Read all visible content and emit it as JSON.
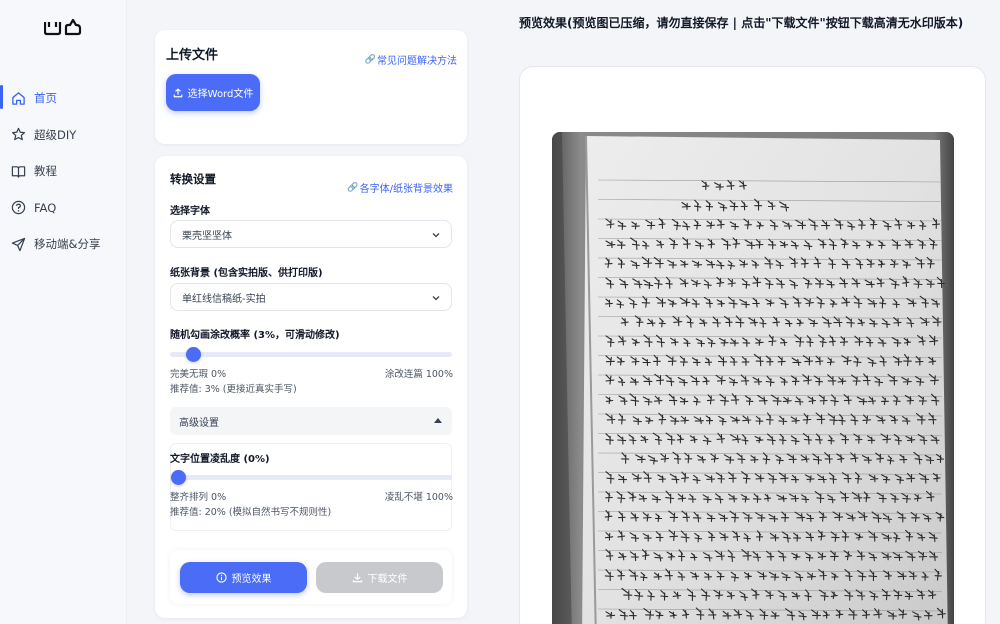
{
  "sidebar": {
    "items": [
      {
        "label": "首页",
        "icon": "home-icon",
        "active": true
      },
      {
        "label": "超级DIY",
        "icon": "star-icon",
        "active": false
      },
      {
        "label": "教程",
        "icon": "book-icon",
        "active": false
      },
      {
        "label": "FAQ",
        "icon": "help-icon",
        "active": false
      },
      {
        "label": "移动端&分享",
        "icon": "send-icon",
        "active": false
      }
    ]
  },
  "upload": {
    "title": "上传文件",
    "faq_link": "常见问题解决方法",
    "button": "选择Word文件"
  },
  "settings": {
    "title": "转换设置",
    "effects_link": "各字体/纸张背景效果",
    "font_label": "选择字体",
    "font_value": "栗壳坚坚体",
    "paper_label": "纸张背景 (包含实拍版、供打印版)",
    "paper_value": "单红线信稿纸-实拍",
    "scribble_label": "随机勾画涂改概率 (3%，可滑动修改)",
    "scribble_value": 3,
    "scribble_min": "完美无瑕 0%",
    "scribble_max": "涂改连篇 100%",
    "scribble_recommend": "推荐值: 3% (更接近真实手写)",
    "advanced_label": "高级设置",
    "disorder_label": "文字位置凌乱度 (0%)",
    "disorder_value": 0,
    "disorder_min": "整齐排列 0%",
    "disorder_max": "凌乱不堪 100%",
    "disorder_recommend": "推荐值: 20% (模拟自然书写不规则性)",
    "preview_button": "预览效果",
    "download_button": "下载文件"
  },
  "preview": {
    "title": "预览效果(预览图已压缩，请勿直接保存 | 点击\"下载文件\"按钮下载高清无水印版本)"
  },
  "colors": {
    "accent": "#4a6cf7",
    "disabled": "#c8c9cc"
  }
}
